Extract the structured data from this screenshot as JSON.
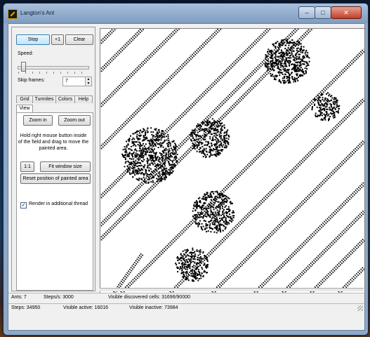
{
  "window": {
    "title": "Langton's Ant",
    "controls": {
      "minimize": "–",
      "maximize": "□",
      "close": "✕"
    }
  },
  "toolbar": {
    "stop": "Stop",
    "plus_one": "+1",
    "clear": "Clear"
  },
  "speed": {
    "label": "Speed:",
    "level": 0.05
  },
  "skip_frames": {
    "label": "Skip frames:",
    "value": "7"
  },
  "tabs": {
    "row1": [
      "Grid",
      "Turmites",
      "Colors",
      "Help"
    ],
    "row2": [
      "View"
    ],
    "active": "View"
  },
  "view_tab": {
    "zoom_in": "Zoom in",
    "zoom_out": "Zoom out",
    "hint": "Hold right mouse button inside of the field and drag to move the painted area.",
    "one_to_one": "1:1",
    "fit_window": "Fit window size",
    "reset_position": "Reset position of painted area",
    "render_thread": {
      "label": "Render in additional thread",
      "checked": true
    }
  },
  "status_row1": {
    "ants": "Ants: 7",
    "steps_per_sec": "Steps/s: 3000",
    "visible_cells": "Visible discovered cells: 31696/90000"
  },
  "status_row2": {
    "steps": "Steps: 34950",
    "visible_active": "Visible active: 16016",
    "visible_inactive": "Visible inactive: 73984"
  },
  "colors": {
    "accent": "#3c7fb1",
    "field_bg": "#ffffff",
    "ink": "#000000",
    "titlebar": "#8ea8c8"
  }
}
